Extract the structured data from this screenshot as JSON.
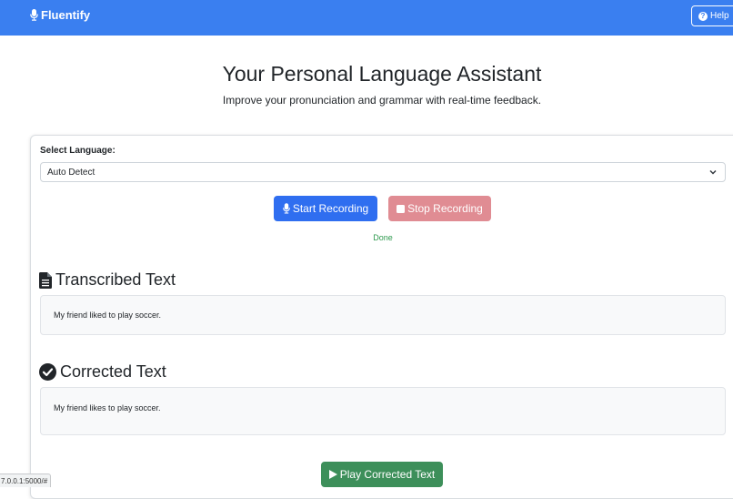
{
  "navbar": {
    "brand": "Fluentify",
    "help_label": "Help"
  },
  "hero": {
    "title": "Your Personal Language Assistant",
    "subtitle": "Improve your pronunciation and grammar with real-time feedback."
  },
  "language": {
    "label": "Select Language:",
    "selected": "Auto Detect"
  },
  "controls": {
    "start_label": "Start Recording",
    "stop_label": "Stop Recording",
    "status": "Done"
  },
  "transcribed": {
    "heading": "Transcribed Text",
    "text": "My friend liked to play soccer."
  },
  "corrected": {
    "heading": "Corrected Text",
    "text": "My friend likes to play soccer."
  },
  "play": {
    "label": "Play Corrected Text"
  },
  "status_bar": {
    "url": "7.0.0.1:5000/#"
  },
  "colors": {
    "navbar": "#3a7ff0",
    "start_button": "#2f6ef0",
    "stop_button": "#e08c93",
    "play_button": "#3d8f5a",
    "status_text": "#2e9a4e"
  },
  "icons": {
    "brand": "microphone-icon",
    "help": "question-circle-icon",
    "start": "microphone-icon",
    "stop": "stop-square-icon",
    "transcribed": "document-icon",
    "corrected": "check-circle-icon",
    "play": "play-icon",
    "select": "chevron-down-icon"
  }
}
